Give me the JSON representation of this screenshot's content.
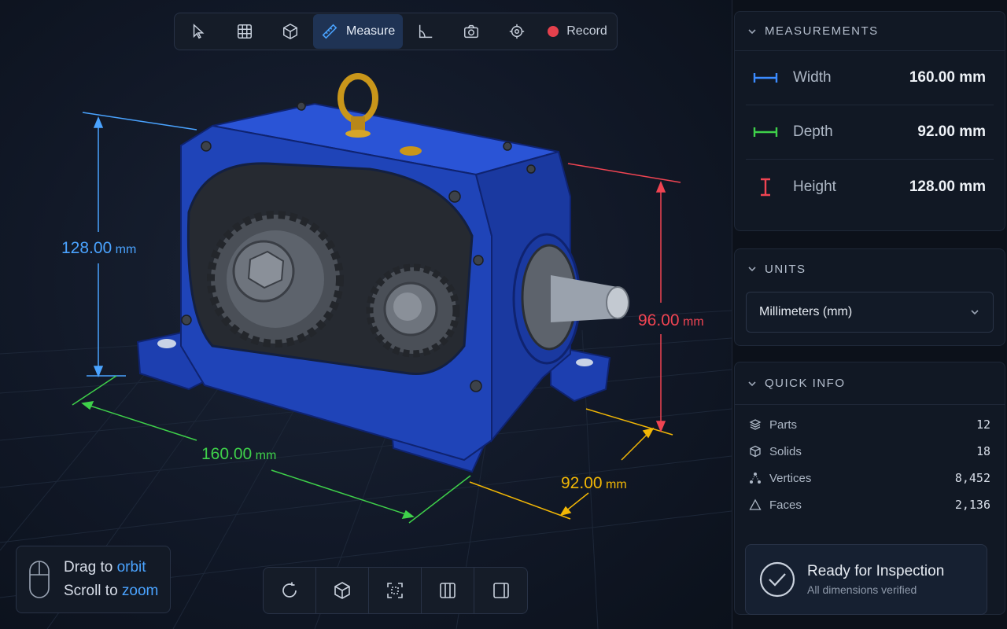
{
  "toolbar": {
    "tools": [
      {
        "icon": "cursor-icon",
        "label": ""
      },
      {
        "icon": "grid-icon",
        "label": ""
      },
      {
        "icon": "cube-icon",
        "label": ""
      },
      {
        "icon": "ruler-icon",
        "label": "Measure",
        "active": true
      },
      {
        "icon": "axis-angle-icon",
        "label": ""
      },
      {
        "icon": "camera-icon",
        "label": ""
      },
      {
        "icon": "target-icon",
        "label": ""
      },
      {
        "icon": "record-dot-icon",
        "label": "Record"
      }
    ],
    "measure_label": "Measure",
    "record_label": "Record"
  },
  "viewport": {
    "dims": {
      "height_value": "128.00",
      "height_unit": "mm",
      "width_value": "160.00",
      "width_unit": "mm",
      "depth_value": "92.00",
      "depth_unit": "mm",
      "shaft_height_value": "96.00",
      "shaft_height_unit": "mm"
    },
    "colors": {
      "height": "#4aa3ff",
      "width": "#3fd14a",
      "depth": "#f2b705",
      "shaft": "#f04452",
      "housing": "#1f44b8"
    }
  },
  "hint": {
    "line1_prefix": "Drag to ",
    "line1_accent": "orbit",
    "line2_prefix": "Scroll to ",
    "line2_accent": "zoom"
  },
  "bottombar": {
    "buttons": [
      "reset-rotation-icon",
      "isometric-cube-icon",
      "fit-view-icon",
      "section-view-icon",
      "panel-toggle-icon"
    ]
  },
  "panel": {
    "measurements": {
      "title": "MEASUREMENTS",
      "rows": [
        {
          "label": "Width",
          "value": "160.00 mm",
          "color": "#3b8bff"
        },
        {
          "label": "Depth",
          "value": "92.00 mm",
          "color": "#3fd14a"
        },
        {
          "label": "Height",
          "value": "128.00 mm",
          "color": "#f04452"
        }
      ]
    },
    "units": {
      "title": "UNITS",
      "selected": "Millimeters (mm)"
    },
    "quick_info": {
      "title": "QUICK INFO",
      "rows": [
        {
          "icon": "layers-icon",
          "label": "Parts",
          "value": "12"
        },
        {
          "icon": "solid-cube-icon",
          "label": "Solids",
          "value": "18"
        },
        {
          "icon": "vertices-icon",
          "label": "Vertices",
          "value": "8,452"
        },
        {
          "icon": "triangle-icon",
          "label": "Faces",
          "value": "2,136"
        }
      ]
    },
    "status": {
      "title": "Ready for Inspection",
      "subtitle": "All dimensions verified"
    }
  }
}
